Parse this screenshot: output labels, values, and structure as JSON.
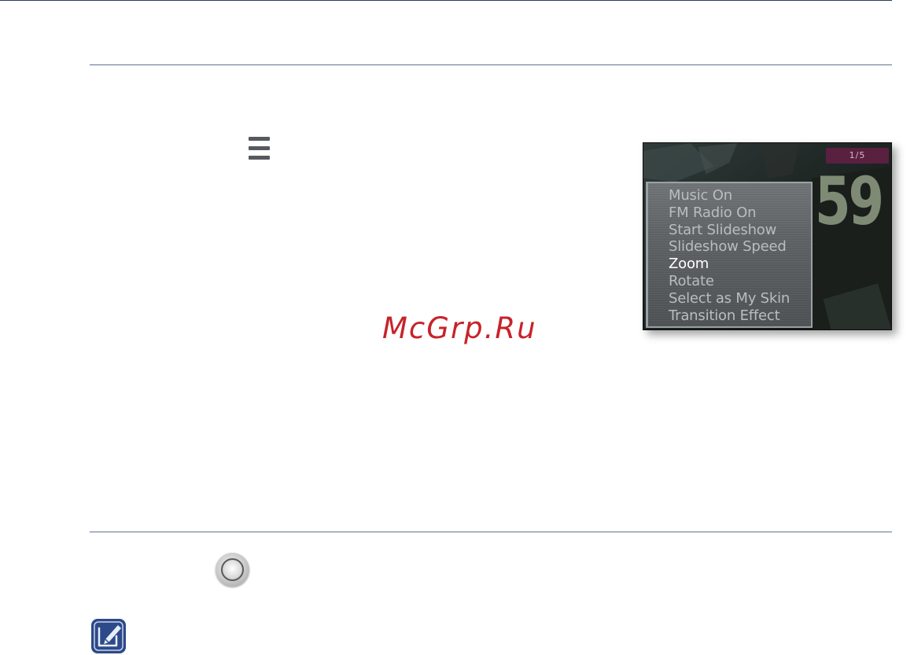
{
  "watermark": {
    "text": "McGrp.Ru"
  },
  "device_screen": {
    "counter": "1/5",
    "background_number": "59",
    "menu_items": [
      "Music On",
      "FM Radio On",
      "Start Slideshow",
      "Slideshow Speed",
      "Zoom",
      "Rotate",
      "Select as My Skin",
      "Transition Effect"
    ],
    "selected_item": "Zoom"
  },
  "icons": {
    "menu": "menu-icon",
    "dial": "select-button-icon",
    "note": "note-icon"
  },
  "colors": {
    "rule": "#5c7390",
    "watermark": "#c8222a",
    "menu_badge": "#5a2040",
    "note_icon": "#2c4a8a"
  }
}
